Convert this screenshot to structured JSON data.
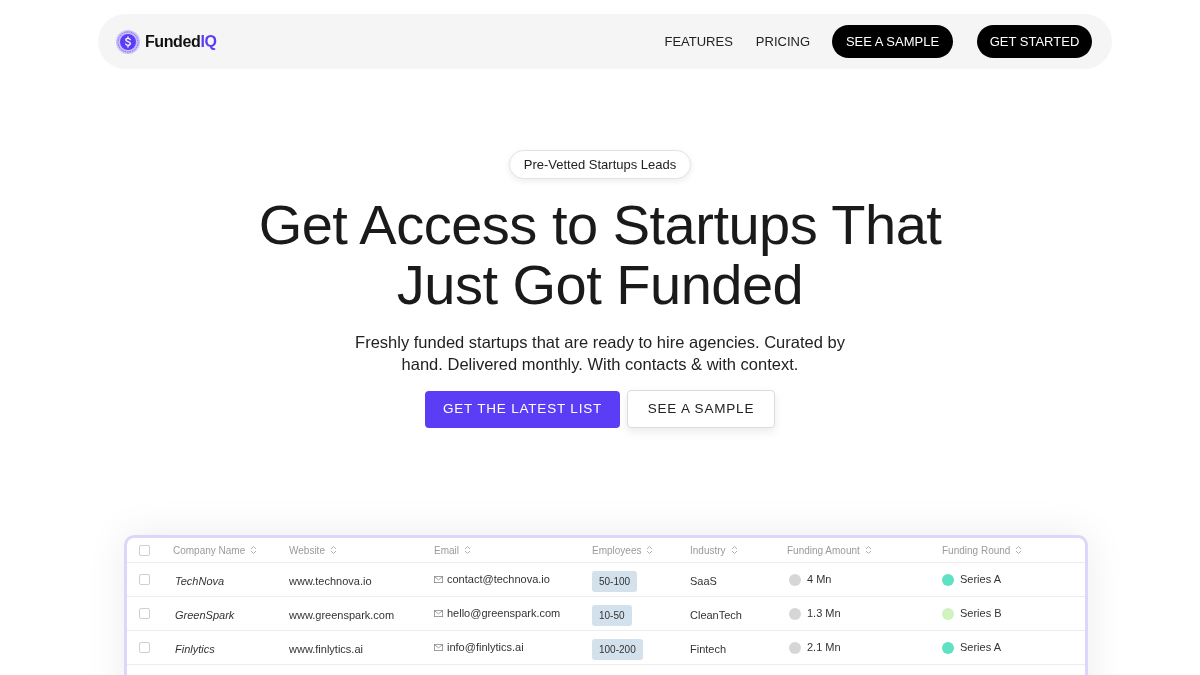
{
  "nav": {
    "logo": {
      "name": "Funded",
      "accent": "IQ"
    },
    "links": [
      "FEATURES",
      "PRICING"
    ],
    "buttons": [
      "SEE A SAMPLE",
      "GET STARTED"
    ]
  },
  "hero": {
    "badge": "Pre-Vetted Startups Leads",
    "title": "Get Access to Startups That Just Got Funded",
    "subtitle": "Freshly funded startups that are ready to hire agencies. Curated by hand. Delivered monthly. With contacts & with context.",
    "buttons": [
      {
        "label": "GET THE LATEST LIST",
        "kind": "primary"
      },
      {
        "label": "SEE A SAMPLE",
        "kind": "secondary"
      }
    ]
  },
  "table": {
    "select_all_checked": false,
    "columns": [
      "Company Name",
      "Website",
      "Email",
      "Employees",
      "Industry",
      "Funding Amount",
      "Funding Round"
    ],
    "rows": [
      {
        "checked": false,
        "company": "TechNova",
        "website": "www.technova.io",
        "email": "contact@technova.io",
        "employees": "50-100",
        "industry": "SaaS",
        "funding_amount": "4 Mn",
        "funding_round": {
          "label": "Series A",
          "color": "#5fe2c3"
        }
      },
      {
        "checked": false,
        "company": "GreenSpark",
        "website": "www.greenspark.com",
        "email": "hello@greenspark.com",
        "employees": "10-50",
        "industry": "CleanTech",
        "funding_amount": "1.3 Mn",
        "funding_round": {
          "label": "Series B",
          "color": "#d0f3c0"
        }
      },
      {
        "checked": false,
        "company": "Finlytics",
        "website": "www.finlytics.ai",
        "email": "info@finlytics.ai",
        "employees": "100-200",
        "industry": "Fintech",
        "funding_amount": "2.1 Mn",
        "funding_round": {
          "label": "Series A",
          "color": "#5fe2c3"
        }
      }
    ]
  }
}
